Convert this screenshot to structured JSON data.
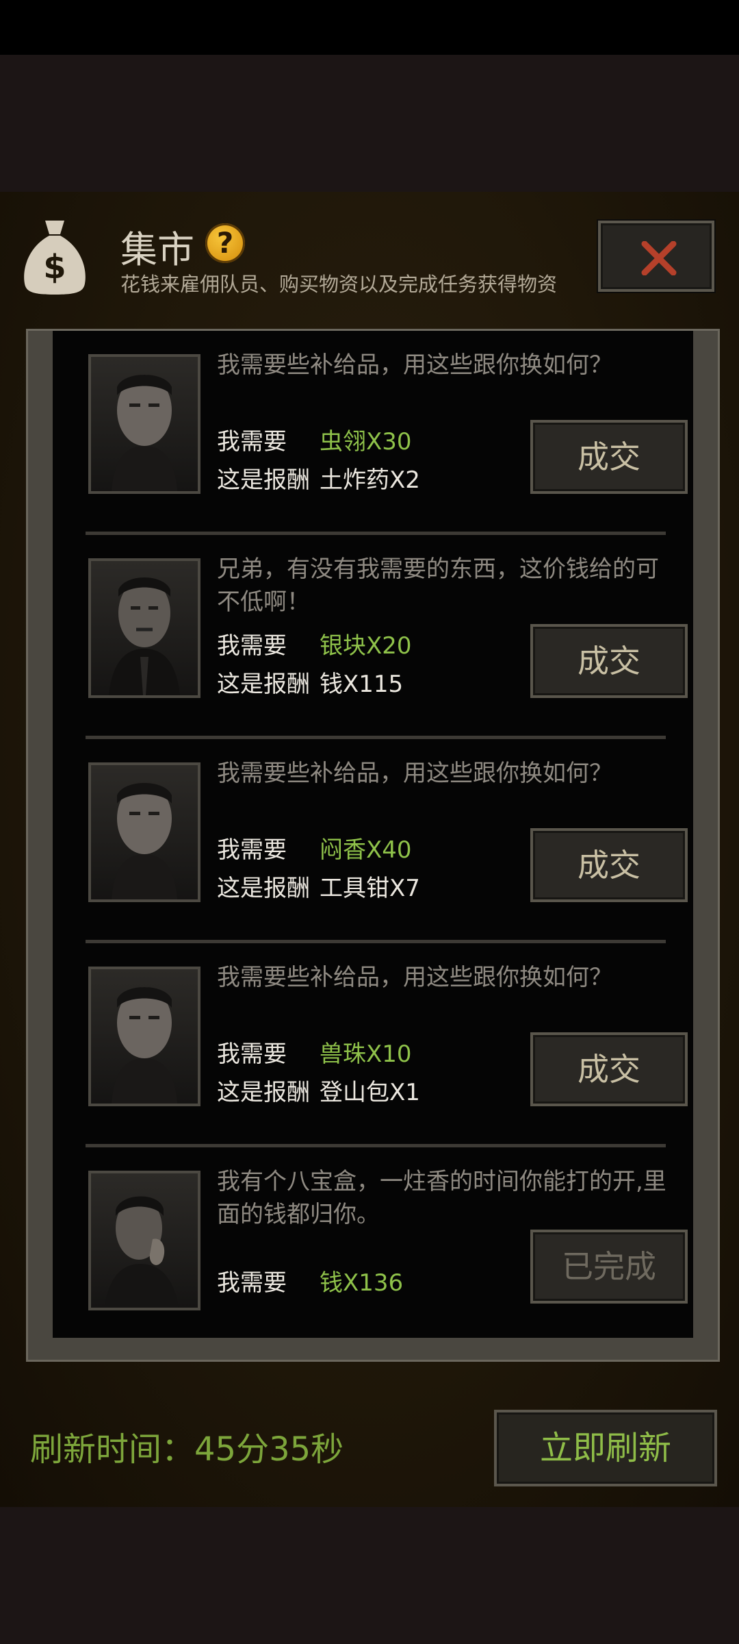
{
  "header": {
    "title": "集市",
    "subtitle": "花钱来雇佣队员、购买物资以及完成任务获得物资",
    "help_icon": "?",
    "bag_icon_glyph": "$"
  },
  "trades": [
    {
      "dialog": "我需要些补给品，用这些跟你换如何？",
      "need_label": "我需要",
      "need_value": "虫翎X30",
      "reward_label": "这是报酬",
      "reward_value": "土炸药X2",
      "button": "成交"
    },
    {
      "dialog": "兄弟，有没有我需要的东西，这价钱给的可不低啊！",
      "need_label": "我需要",
      "need_value": "银块X20",
      "reward_label": "这是报酬",
      "reward_value": "钱X115",
      "button": "成交"
    },
    {
      "dialog": "我需要些补给品，用这些跟你换如何？",
      "need_label": "我需要",
      "need_value": "闷香X40",
      "reward_label": "这是报酬",
      "reward_value": "工具钳X7",
      "button": "成交"
    },
    {
      "dialog": "我需要些补给品，用这些跟你换如何？",
      "need_label": "我需要",
      "need_value": "兽珠X10",
      "reward_label": "这是报酬",
      "reward_value": "登山包X1",
      "button": "成交"
    },
    {
      "dialog": "我有个八宝盒，一炷香的时间你能打的开,里面的钱都归你。",
      "need_label": "我需要",
      "need_value": "钱X136",
      "button": "已完成"
    }
  ],
  "footer": {
    "refresh_text": "刷新时间：45分35秒",
    "refresh_button": "立即刷新"
  },
  "colors": {
    "need_value": "#8fc24a",
    "refresh_text": "#7da63b",
    "close_x": "#b5402a",
    "help_icon": "#f2b321"
  },
  "icons": [
    "money-bag-icon",
    "help-icon",
    "close-icon"
  ]
}
